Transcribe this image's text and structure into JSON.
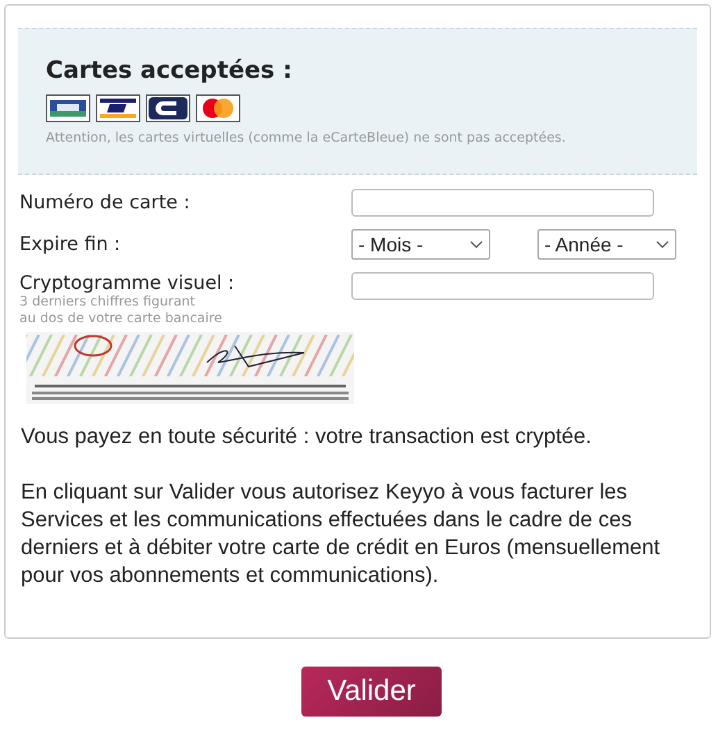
{
  "accepted_cards": {
    "title": "Cartes acceptées :",
    "logos": [
      {
        "kind": "cb"
      },
      {
        "kind": "visa"
      },
      {
        "kind": "e"
      },
      {
        "kind": "mastercard"
      }
    ],
    "notice": "Attention, les cartes virtuelles (comme la eCarteBleue) ne sont pas acceptées."
  },
  "form": {
    "card_number": {
      "label": "Numéro de carte :"
    },
    "expiry": {
      "label": "Expire fin :",
      "month": "- Mois -",
      "year": "- Année -"
    },
    "cvv": {
      "label": "Cryptogramme visuel :",
      "hint_lines": [
        "3 derniers chiffres figurant",
        "au dos de votre carte bancaire"
      ]
    }
  },
  "security_note": "Vous payez en toute sécurité : votre transaction est cryptée.",
  "terms": "En cliquant sur Valider vous autorisez Keyyo à vous facturer les Services et les communications effectuées dans le cadre de ces derniers et à débiter votre carte de crédit en Euros (mensuellement pour vos abonnements et communications).",
  "submit": "Valider"
}
